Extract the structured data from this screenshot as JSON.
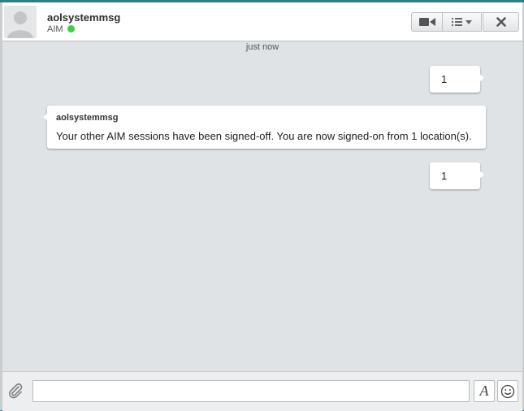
{
  "header": {
    "contact_name": "aolsystemmsg",
    "service": "AIM",
    "status_color": "#3fcf3a",
    "icons": [
      "avatar-placeholder-icon",
      "video-camera-icon",
      "list-menu-icon",
      "close-icon"
    ]
  },
  "conversation": {
    "timestamp": "just now",
    "messages": [
      {
        "direction": "outgoing",
        "text": "1"
      },
      {
        "direction": "incoming",
        "sender": "aolsystemmsg",
        "text": "Your other AIM sessions have been signed-off.  You are now signed-on from 1 location(s)."
      },
      {
        "direction": "outgoing",
        "text": "1"
      }
    ]
  },
  "composer": {
    "input_value": "",
    "font_button_label": "A",
    "icons": [
      "paperclip-icon",
      "smiley-icon"
    ]
  }
}
